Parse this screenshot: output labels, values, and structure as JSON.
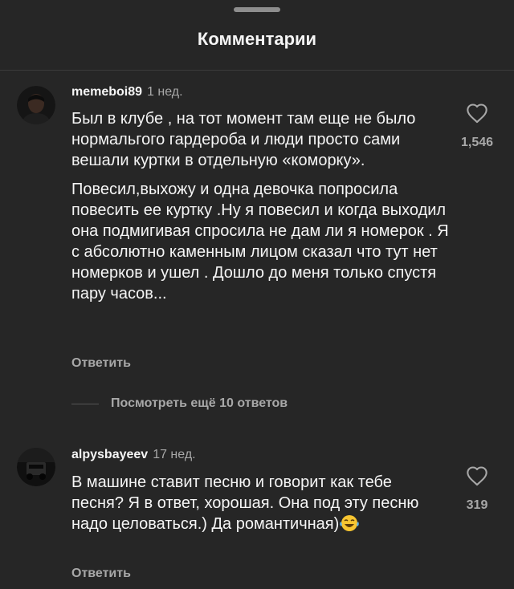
{
  "sheet": {
    "title": "Комментарии"
  },
  "comments": [
    {
      "username": "memeboi89",
      "time": "1 нед.",
      "paragraphs": [
        "Был в клубе , на тот момент там еще не было нормальгого гардероба и люди просто сами вешали куртки в отдельную «коморку».",
        "Повесил,выхожу и одна девочка попросила повесить ее куртку .Ну я повесил и когда выходил она подмигивая спросила не дам ли я номерок . Я с абсолютно каменным лицом сказал что тут нет номерков и ушел . Дошло до меня только спустя пару часов..."
      ],
      "likes": "1,546",
      "reply_label": "Ответить",
      "avatar_icon": "user-photo-icon"
    },
    {
      "username": "alpysbayeev",
      "time": "17 нед.",
      "paragraphs": [
        "В машине ставит песню и говорит как тебе песня? Я в ответ, хорошая. Она под эту песню надо целоваться.) Да романтичная)"
      ],
      "emoji_icon": "laughing-tears-emoji-icon",
      "likes": "319",
      "reply_label": "Ответить",
      "avatar_icon": "car-photo-icon"
    }
  ],
  "view_more_replies": "Посмотреть ещё 10 ответов",
  "colors": {
    "background": "#262626",
    "text": "#f5f5f5",
    "secondary": "#a8a8a8"
  }
}
